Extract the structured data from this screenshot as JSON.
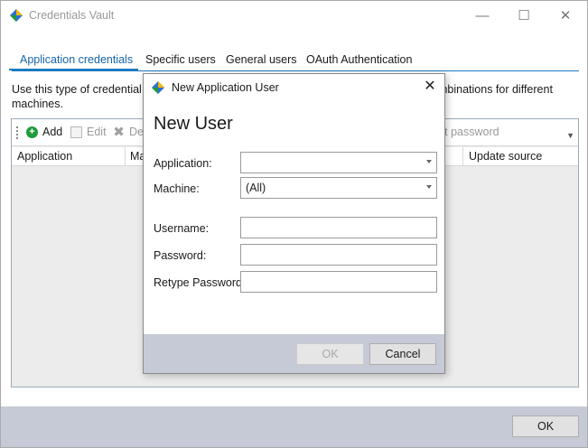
{
  "window": {
    "title": "Credentials Vault",
    "minimize_glyph": "—",
    "maximize_glyph": "☐",
    "close_glyph": "✕",
    "brand_colors": [
      "#2f6fd6",
      "#f5b700",
      "#1e9b3a"
    ]
  },
  "tabs": [
    {
      "label": "Application credentials",
      "active": true
    },
    {
      "label": "Specific users",
      "active": false
    },
    {
      "label": "General users",
      "active": false
    },
    {
      "label": "OAuth Authentication",
      "active": false
    }
  ],
  "description": {
    "left": "Use this type of credential w",
    "right": "mbinations for different",
    "line2": "machines."
  },
  "toolbar": {
    "add_label": "Add",
    "edit_label": "Edit",
    "delete_label": "De",
    "overflow_label": "rt password",
    "overflow_arrow": "▼"
  },
  "columns": [
    {
      "label": "Application"
    },
    {
      "label": "Ma"
    },
    {
      "label": "Update source"
    }
  ],
  "footer": {
    "ok_label": "OK"
  },
  "dialog": {
    "title": "New Application User",
    "close_glyph": "✕",
    "heading": "New User",
    "fields": {
      "application": {
        "label": "Application:",
        "value": ""
      },
      "machine": {
        "label": "Machine:",
        "value": "(All)"
      },
      "username": {
        "label": "Username:",
        "value": ""
      },
      "password": {
        "label": "Password:",
        "value": ""
      },
      "retype_password": {
        "label": "Retype Password:",
        "value": ""
      }
    },
    "ok_label": "OK",
    "ok_enabled": false,
    "cancel_label": "Cancel"
  }
}
